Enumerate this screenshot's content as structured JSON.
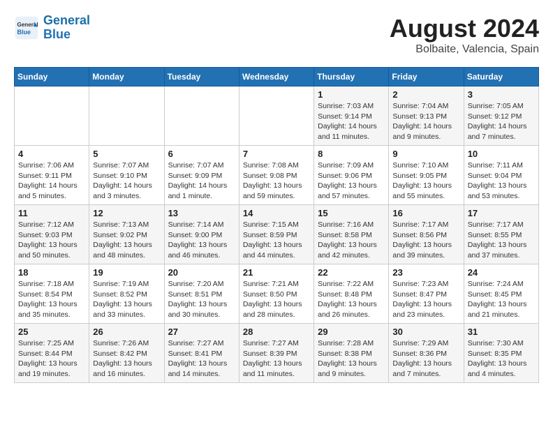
{
  "header": {
    "logo_general": "General",
    "logo_blue": "Blue",
    "month_title": "August 2024",
    "location": "Bolbaite, Valencia, Spain"
  },
  "weekdays": [
    "Sunday",
    "Monday",
    "Tuesday",
    "Wednesday",
    "Thursday",
    "Friday",
    "Saturday"
  ],
  "weeks": [
    [
      {
        "day": "",
        "info": ""
      },
      {
        "day": "",
        "info": ""
      },
      {
        "day": "",
        "info": ""
      },
      {
        "day": "",
        "info": ""
      },
      {
        "day": "1",
        "info": "Sunrise: 7:03 AM\nSunset: 9:14 PM\nDaylight: 14 hours\nand 11 minutes."
      },
      {
        "day": "2",
        "info": "Sunrise: 7:04 AM\nSunset: 9:13 PM\nDaylight: 14 hours\nand 9 minutes."
      },
      {
        "day": "3",
        "info": "Sunrise: 7:05 AM\nSunset: 9:12 PM\nDaylight: 14 hours\nand 7 minutes."
      }
    ],
    [
      {
        "day": "4",
        "info": "Sunrise: 7:06 AM\nSunset: 9:11 PM\nDaylight: 14 hours\nand 5 minutes."
      },
      {
        "day": "5",
        "info": "Sunrise: 7:07 AM\nSunset: 9:10 PM\nDaylight: 14 hours\nand 3 minutes."
      },
      {
        "day": "6",
        "info": "Sunrise: 7:07 AM\nSunset: 9:09 PM\nDaylight: 14 hours\nand 1 minute."
      },
      {
        "day": "7",
        "info": "Sunrise: 7:08 AM\nSunset: 9:08 PM\nDaylight: 13 hours\nand 59 minutes."
      },
      {
        "day": "8",
        "info": "Sunrise: 7:09 AM\nSunset: 9:06 PM\nDaylight: 13 hours\nand 57 minutes."
      },
      {
        "day": "9",
        "info": "Sunrise: 7:10 AM\nSunset: 9:05 PM\nDaylight: 13 hours\nand 55 minutes."
      },
      {
        "day": "10",
        "info": "Sunrise: 7:11 AM\nSunset: 9:04 PM\nDaylight: 13 hours\nand 53 minutes."
      }
    ],
    [
      {
        "day": "11",
        "info": "Sunrise: 7:12 AM\nSunset: 9:03 PM\nDaylight: 13 hours\nand 50 minutes."
      },
      {
        "day": "12",
        "info": "Sunrise: 7:13 AM\nSunset: 9:02 PM\nDaylight: 13 hours\nand 48 minutes."
      },
      {
        "day": "13",
        "info": "Sunrise: 7:14 AM\nSunset: 9:00 PM\nDaylight: 13 hours\nand 46 minutes."
      },
      {
        "day": "14",
        "info": "Sunrise: 7:15 AM\nSunset: 8:59 PM\nDaylight: 13 hours\nand 44 minutes."
      },
      {
        "day": "15",
        "info": "Sunrise: 7:16 AM\nSunset: 8:58 PM\nDaylight: 13 hours\nand 42 minutes."
      },
      {
        "day": "16",
        "info": "Sunrise: 7:17 AM\nSunset: 8:56 PM\nDaylight: 13 hours\nand 39 minutes."
      },
      {
        "day": "17",
        "info": "Sunrise: 7:17 AM\nSunset: 8:55 PM\nDaylight: 13 hours\nand 37 minutes."
      }
    ],
    [
      {
        "day": "18",
        "info": "Sunrise: 7:18 AM\nSunset: 8:54 PM\nDaylight: 13 hours\nand 35 minutes."
      },
      {
        "day": "19",
        "info": "Sunrise: 7:19 AM\nSunset: 8:52 PM\nDaylight: 13 hours\nand 33 minutes."
      },
      {
        "day": "20",
        "info": "Sunrise: 7:20 AM\nSunset: 8:51 PM\nDaylight: 13 hours\nand 30 minutes."
      },
      {
        "day": "21",
        "info": "Sunrise: 7:21 AM\nSunset: 8:50 PM\nDaylight: 13 hours\nand 28 minutes."
      },
      {
        "day": "22",
        "info": "Sunrise: 7:22 AM\nSunset: 8:48 PM\nDaylight: 13 hours\nand 26 minutes."
      },
      {
        "day": "23",
        "info": "Sunrise: 7:23 AM\nSunset: 8:47 PM\nDaylight: 13 hours\nand 23 minutes."
      },
      {
        "day": "24",
        "info": "Sunrise: 7:24 AM\nSunset: 8:45 PM\nDaylight: 13 hours\nand 21 minutes."
      }
    ],
    [
      {
        "day": "25",
        "info": "Sunrise: 7:25 AM\nSunset: 8:44 PM\nDaylight: 13 hours\nand 19 minutes."
      },
      {
        "day": "26",
        "info": "Sunrise: 7:26 AM\nSunset: 8:42 PM\nDaylight: 13 hours\nand 16 minutes."
      },
      {
        "day": "27",
        "info": "Sunrise: 7:27 AM\nSunset: 8:41 PM\nDaylight: 13 hours\nand 14 minutes."
      },
      {
        "day": "28",
        "info": "Sunrise: 7:27 AM\nSunset: 8:39 PM\nDaylight: 13 hours\nand 11 minutes."
      },
      {
        "day": "29",
        "info": "Sunrise: 7:28 AM\nSunset: 8:38 PM\nDaylight: 13 hours\nand 9 minutes."
      },
      {
        "day": "30",
        "info": "Sunrise: 7:29 AM\nSunset: 8:36 PM\nDaylight: 13 hours\nand 7 minutes."
      },
      {
        "day": "31",
        "info": "Sunrise: 7:30 AM\nSunset: 8:35 PM\nDaylight: 13 hours\nand 4 minutes."
      }
    ]
  ]
}
